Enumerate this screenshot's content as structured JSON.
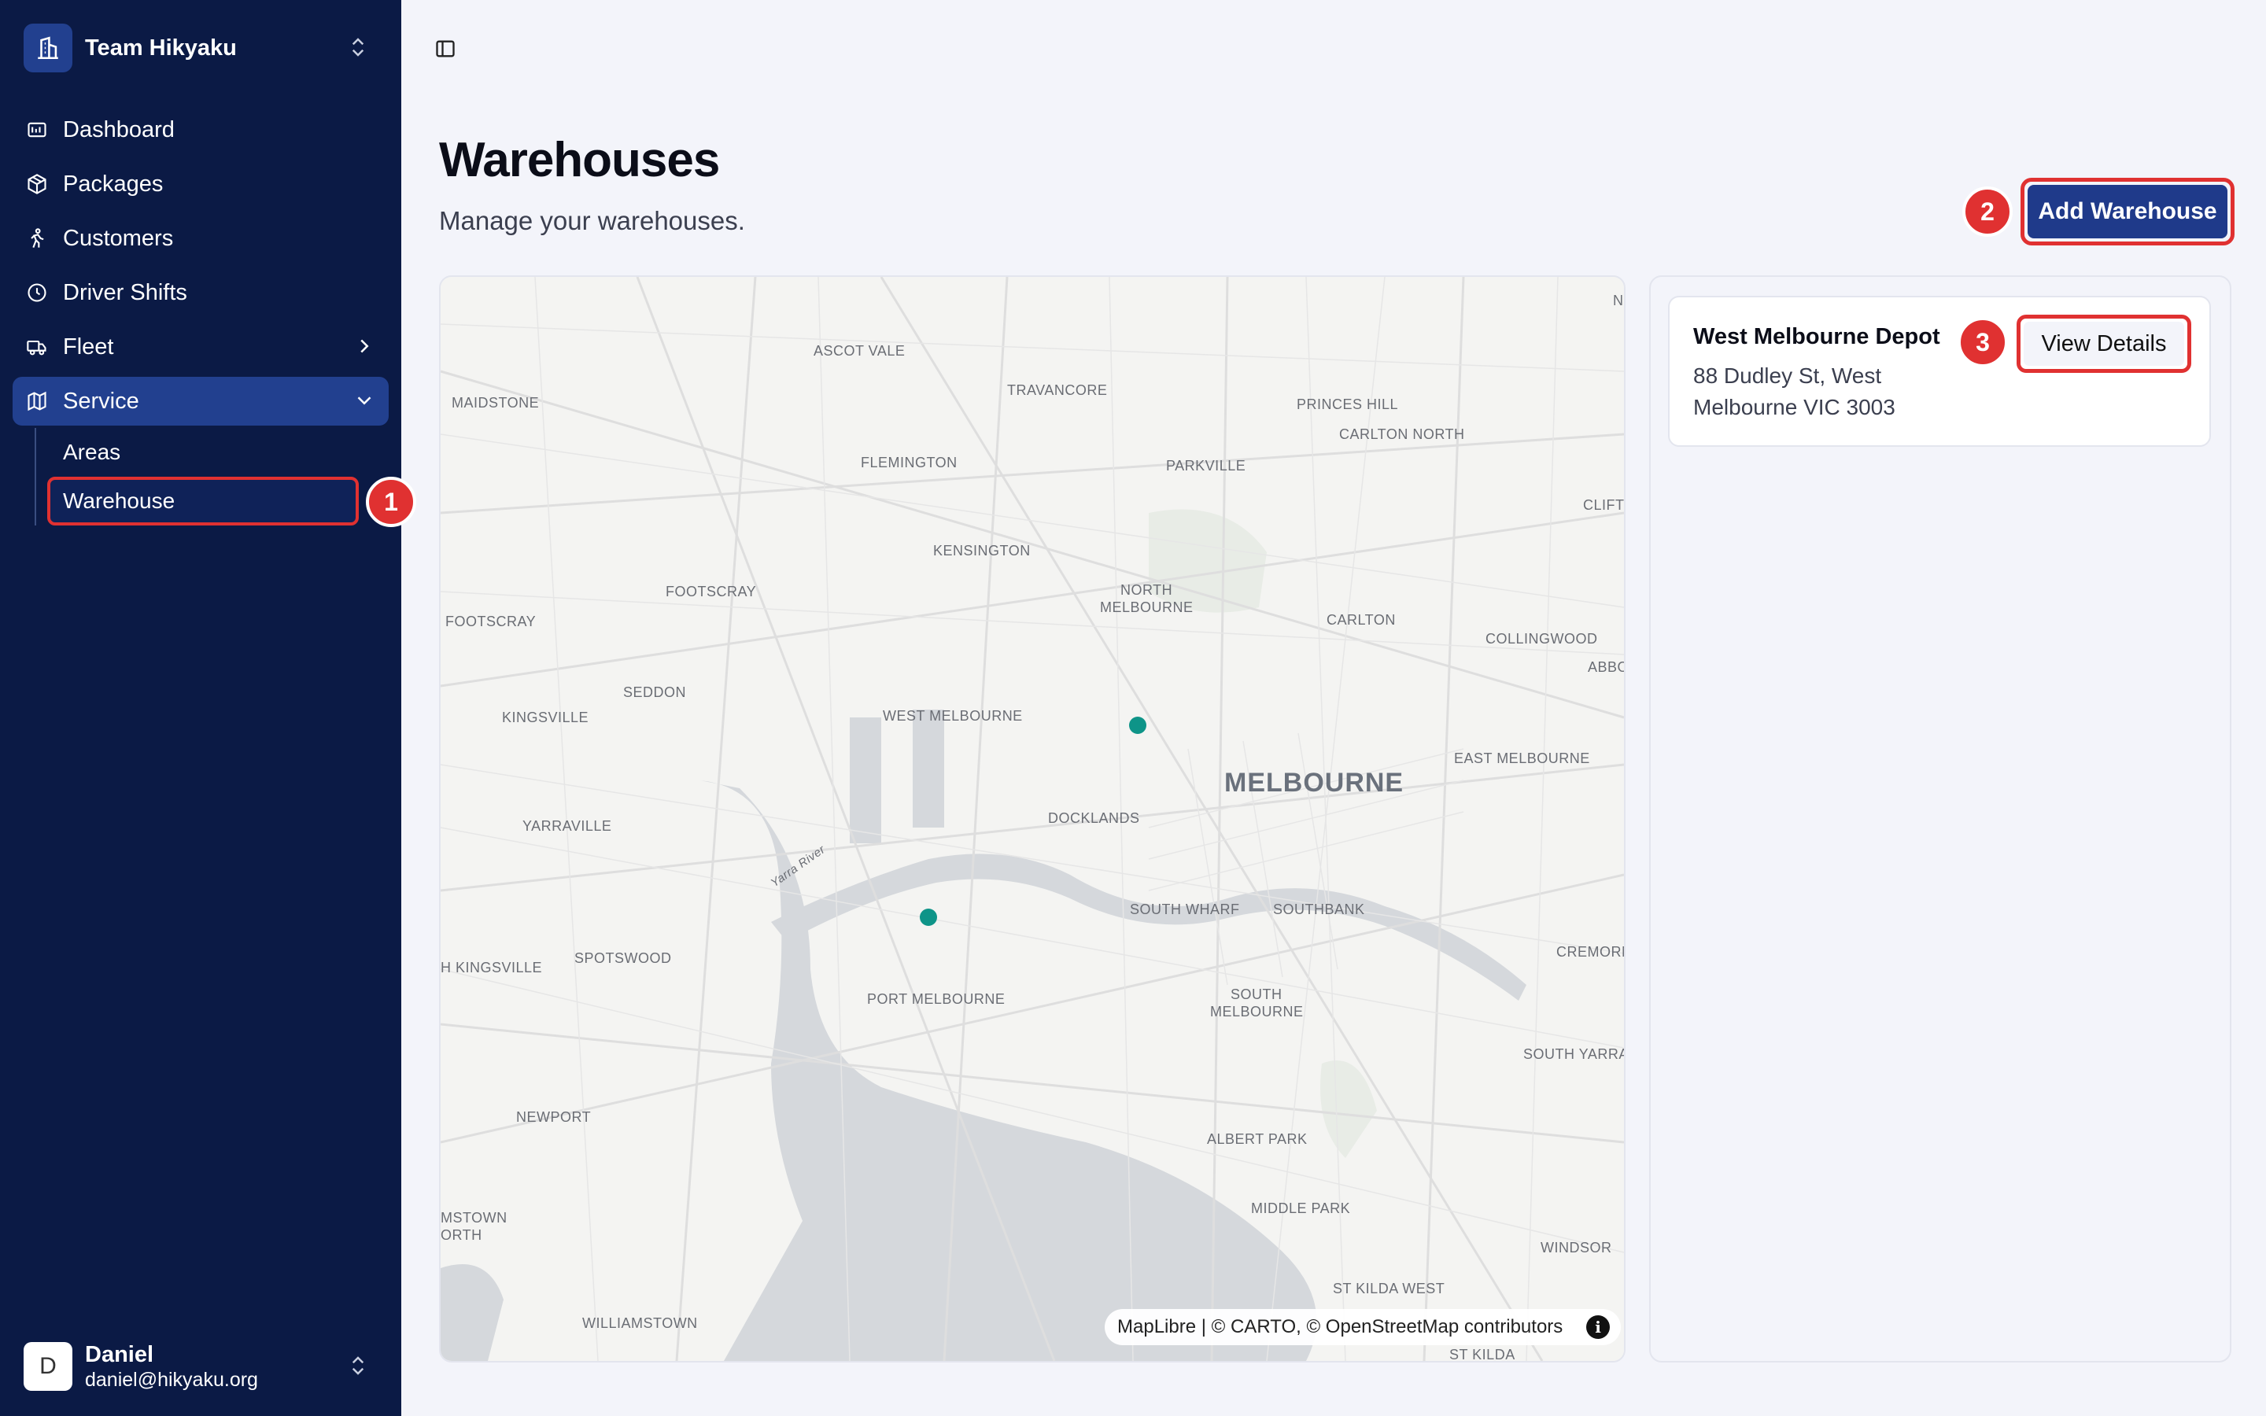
{
  "sidebar": {
    "team_name": "Team Hikyaku",
    "nav": [
      {
        "label": "Dashboard",
        "icon": "dashboard-icon"
      },
      {
        "label": "Packages",
        "icon": "package-icon"
      },
      {
        "label": "Customers",
        "icon": "customers-icon"
      },
      {
        "label": "Driver Shifts",
        "icon": "clock-icon"
      },
      {
        "label": "Fleet",
        "icon": "truck-icon"
      },
      {
        "label": "Service",
        "icon": "map-icon"
      }
    ],
    "subnav": [
      {
        "label": "Areas"
      },
      {
        "label": "Warehouse"
      }
    ],
    "user": {
      "initial": "D",
      "name": "Daniel",
      "email": "daniel@hikyaku.org"
    }
  },
  "main": {
    "title": "Warehouses",
    "subtitle": "Manage your warehouses.",
    "add_button": "Add Warehouse"
  },
  "map": {
    "labels": [
      "ASCOT VALE",
      "TRAVANCORE",
      "PRINCES HILL",
      "CARLTON NORTH",
      "MAIDSTONE",
      "FLEMINGTON",
      "PARKVILLE",
      "CLIFTC",
      "KENSINGTON",
      "NORTH",
      "MELBOURNE",
      "FOOTSCRAY",
      "FOOTSCRAY",
      "CARLTON",
      "COLLINGWOOD",
      "ABBO",
      "SEDDON",
      "KINGSVILLE",
      "WEST MELBOURNE",
      "EAST MELBOURNE",
      "MELBOURNE",
      "DOCKLANDS",
      "YARRAVILLE",
      "Yarra River",
      "SOUTH WHARF",
      "SOUTHBANK",
      "CREMORNE",
      "H KINGSVILLE",
      "SPOTSWOOD",
      "PORT MELBOURNE",
      "SOUTH",
      "MELBOURNE",
      "SOUTH YARRA",
      "NEWPORT",
      "ALBERT PARK",
      "MIDDLE PARK",
      "WINDSOR",
      "MSTOWN",
      "ORTH",
      "ST KILDA WEST",
      "WILLIAMSTOWN",
      "ST KILDA",
      "N"
    ],
    "attribution": "MapLibre | © CARTO, © OpenStreetMap contributors",
    "marker_color": "#0e9488"
  },
  "warehouses": [
    {
      "name": "West Melbourne Depot",
      "address": "88 Dudley St, West Melbourne VIC 3003",
      "button": "View Details"
    }
  ],
  "annotations": [
    "1",
    "2",
    "3"
  ],
  "colors": {
    "sidebar": "#0b1a45",
    "active": "#22408f",
    "primary_button": "#1f3a8a",
    "highlight": "#e03131",
    "background": "#f3f4fa"
  }
}
